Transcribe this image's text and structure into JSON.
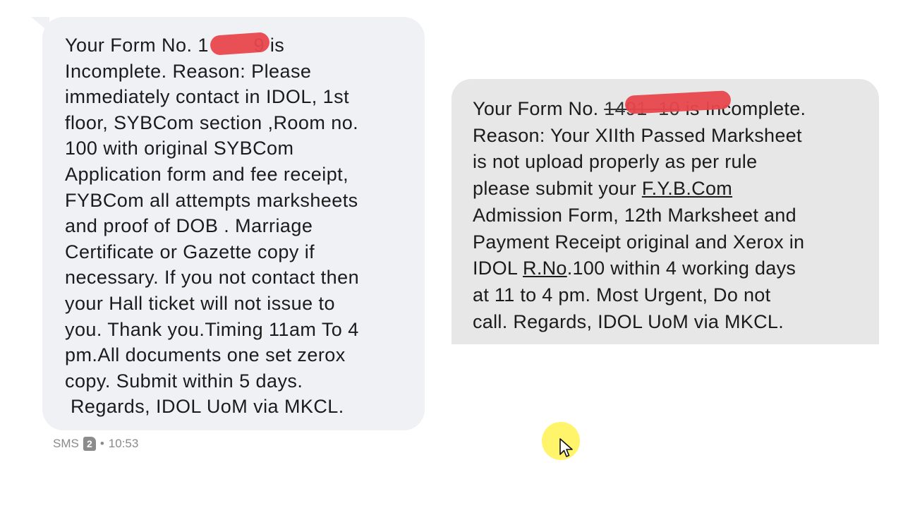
{
  "messages": {
    "left": {
      "lines": [
        "Your Form No. 1        9 is",
        "Incomplete. Reason: Please",
        "immediately contact in IDOL, 1st",
        "floor, SYBCom section ,Room no.",
        "100 with original SYBCom",
        "Application form and fee receipt,",
        "FYBCom all attempts marksheets",
        "and proof of DOB . Marriage",
        "Certificate or Gazette copy if",
        "necessary. If you not contact then",
        "your Hall ticket will not issue to",
        "you. Thank you.Timing 11am To 4",
        "pm.All documents one set zerox",
        "copy. Submit within 5 days.",
        " Regards, IDOL UoM via MKCL."
      ]
    },
    "right": {
      "line1_prefix": "Your Form No. ",
      "line1_hidden": "1491  10",
      "line1_suffix": " is Incomplete.",
      "line2": "Reason: Your XIIth Passed Marksheet",
      "line3": "is not upload properly as per rule",
      "line4_prefix": "please submit your ",
      "line4_link": "F.Y.B.Com",
      "line5": "Admission Form, 12th Marksheet and",
      "line6": "Payment Receipt original and Xerox in",
      "line7_prefix": "IDOL ",
      "line7_link": "R.No",
      "line7_suffix": ".100 within 4 working days",
      "line8": "at 11 to 4 pm. Most Urgent, Do not",
      "line9": "call. Regards, IDOL UoM via MKCL."
    }
  },
  "meta": {
    "channel": "SMS",
    "sim_slot": "2",
    "separator": "•",
    "time": "10:53"
  },
  "colors": {
    "redaction": "#e8474c",
    "left_bubble": "#f0f1f5",
    "right_bubble": "#e7e7e7",
    "cursor_highlight": "#fff35a"
  },
  "icons": {
    "sim": "sim-card-icon",
    "cursor": "mouse-pointer-icon"
  }
}
